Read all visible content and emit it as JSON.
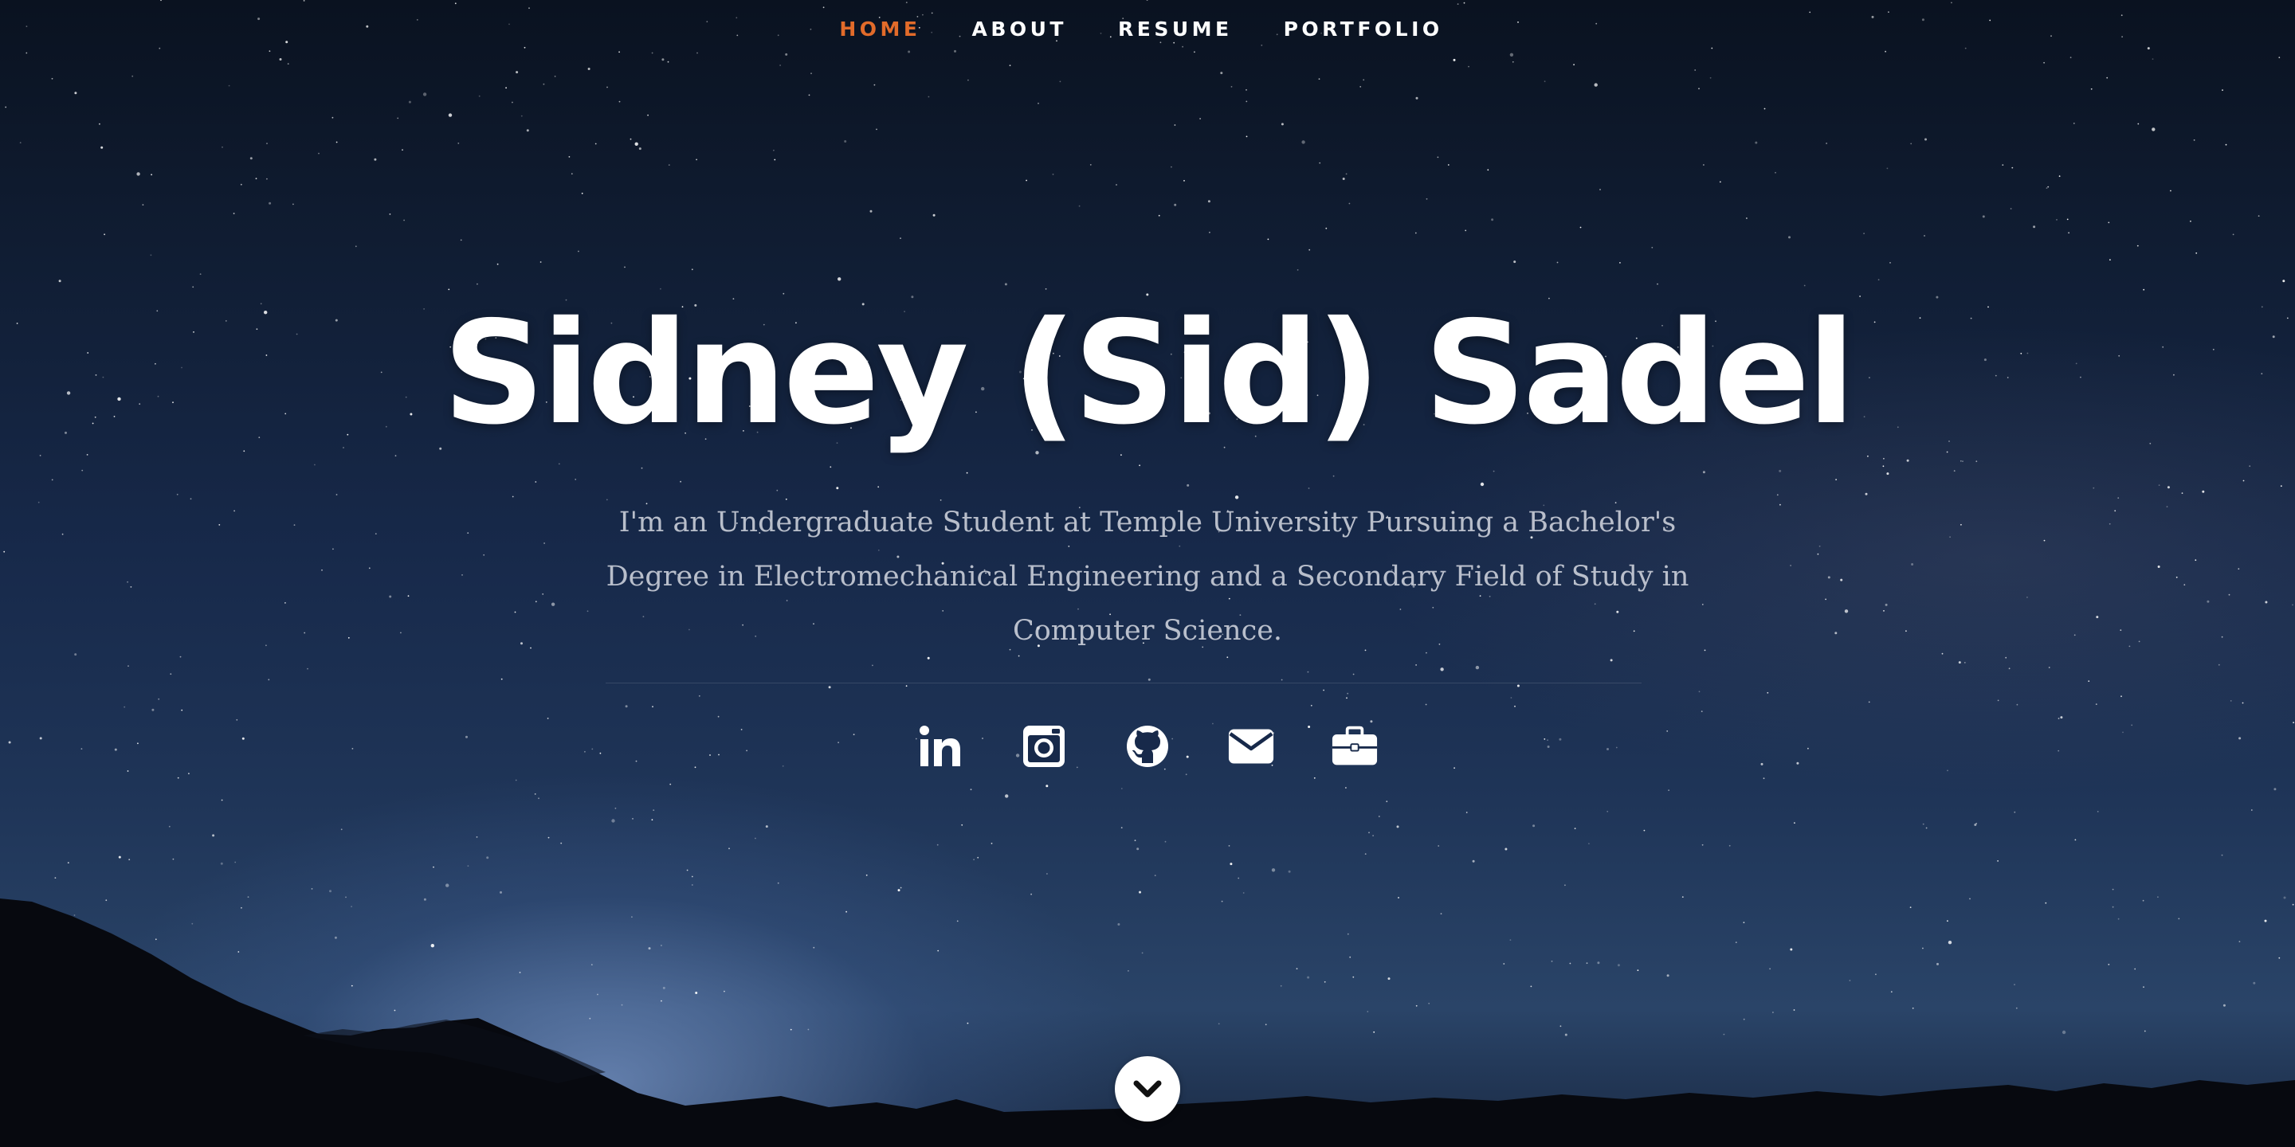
{
  "nav": {
    "items": [
      {
        "label": "HOME",
        "active": true
      },
      {
        "label": "ABOUT",
        "active": false
      },
      {
        "label": "RESUME",
        "active": false
      },
      {
        "label": "PORTFOLIO",
        "active": false
      }
    ]
  },
  "hero": {
    "title": "Sidney (Sid) Sadel",
    "subtitle": "I'm an Undergraduate Student at Temple University Pursuing a Bachelor's Degree in Electromechanical Engineering and a Secondary Field of Study in Computer Science."
  },
  "social": [
    {
      "icon": "linkedin-icon"
    },
    {
      "icon": "instagram-icon"
    },
    {
      "icon": "github-icon"
    },
    {
      "icon": "email-icon"
    },
    {
      "icon": "briefcase-icon"
    }
  ],
  "colors": {
    "accent": "#e26b2a",
    "text": "#ffffff",
    "sky": "#17294a"
  }
}
